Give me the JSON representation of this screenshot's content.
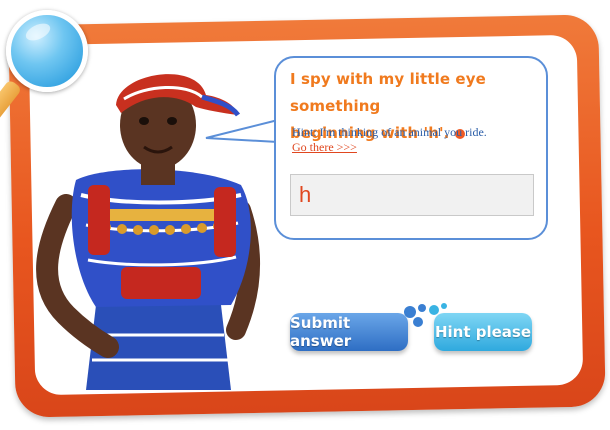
{
  "prompt": {
    "line1": "I spy with my little eye something",
    "line2": "beginning with 'h'."
  },
  "hint_text": "Hint: I'm thinking of an animal you ride.",
  "go_link": "Go there >>>",
  "answer_value": "h",
  "buttons": {
    "submit": "Submit answer",
    "hint": "Hint please"
  },
  "colors": {
    "frame": "#e8561f",
    "prompt_text": "#f07a1e",
    "hint_text": "#2b5ea8",
    "link": "#e0471f",
    "submit_button": "#2e6ec4",
    "hint_button": "#2fa9de"
  },
  "icons": [
    "magnifying-glass-icon",
    "bubble-dot-icon"
  ]
}
